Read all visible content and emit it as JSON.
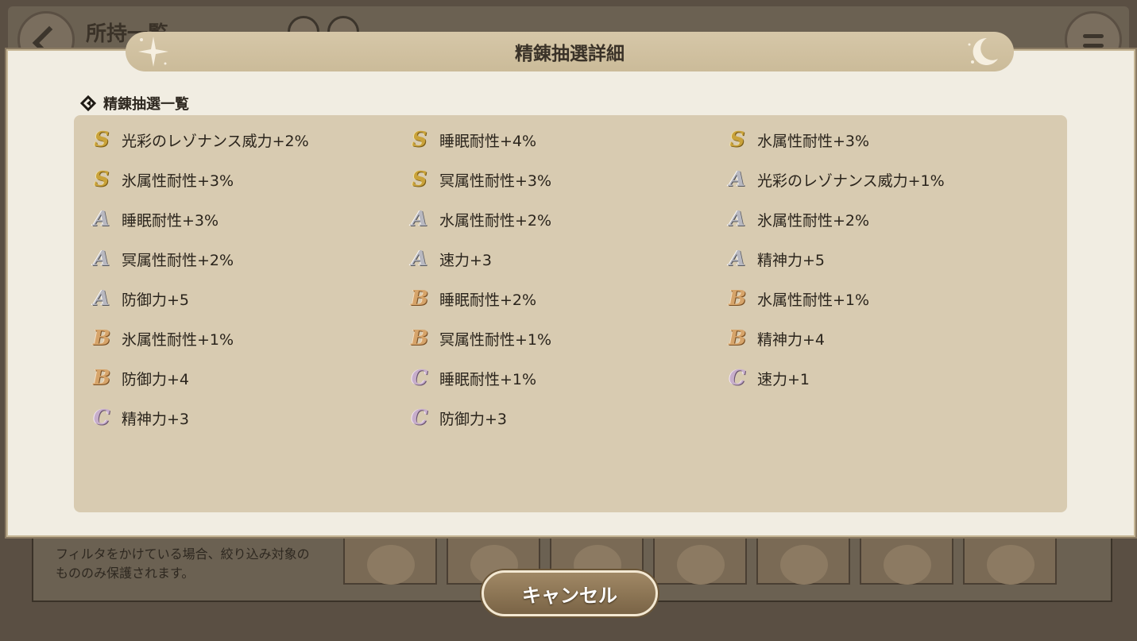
{
  "background": {
    "title": "所持一覧",
    "note": "フィルタをかけている場合、絞り込み対象のもののみ保護されます。"
  },
  "modal": {
    "title": "精錬抽選詳細",
    "section_label": "精錬抽選一覧",
    "entries": [
      {
        "rank": "S",
        "text": "光彩のレゾナンス威力+2%"
      },
      {
        "rank": "S",
        "text": "睡眠耐性+4%"
      },
      {
        "rank": "S",
        "text": "水属性耐性+3%"
      },
      {
        "rank": "S",
        "text": "氷属性耐性+3%"
      },
      {
        "rank": "S",
        "text": "冥属性耐性+3%"
      },
      {
        "rank": "A",
        "text": "光彩のレゾナンス威力+1%"
      },
      {
        "rank": "A",
        "text": "睡眠耐性+3%"
      },
      {
        "rank": "A",
        "text": "水属性耐性+2%"
      },
      {
        "rank": "A",
        "text": "氷属性耐性+2%"
      },
      {
        "rank": "A",
        "text": "冥属性耐性+2%"
      },
      {
        "rank": "A",
        "text": "速力+3"
      },
      {
        "rank": "A",
        "text": "精神力+5"
      },
      {
        "rank": "A",
        "text": "防御力+5"
      },
      {
        "rank": "B",
        "text": "睡眠耐性+2%"
      },
      {
        "rank": "B",
        "text": "水属性耐性+1%"
      },
      {
        "rank": "B",
        "text": "氷属性耐性+1%"
      },
      {
        "rank": "B",
        "text": "冥属性耐性+1%"
      },
      {
        "rank": "B",
        "text": "精神力+4"
      },
      {
        "rank": "B",
        "text": "防御力+4"
      },
      {
        "rank": "C",
        "text": "睡眠耐性+1%"
      },
      {
        "rank": "C",
        "text": "速力+1"
      },
      {
        "rank": "C",
        "text": "精神力+3"
      },
      {
        "rank": "C",
        "text": "防御力+3"
      }
    ],
    "cancel_label": "キャンセル"
  },
  "colors": {
    "modal_bg": "#f1ede2",
    "panel_bg": "#d8cbb1",
    "header_bg": "#cbbb99",
    "button_bg": "#8a7352"
  }
}
